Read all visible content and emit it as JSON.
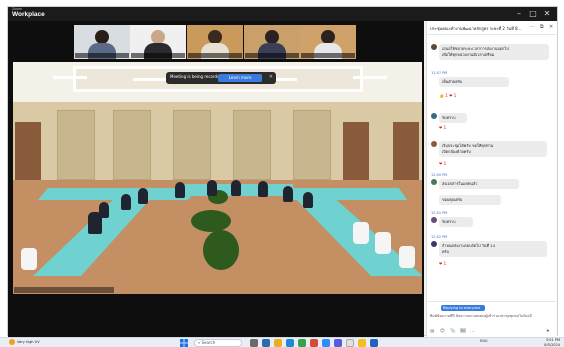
{
  "window": {
    "app_name_small": "Zoom",
    "app_name": "Workplace",
    "controls": {
      "minimize": "–",
      "maximize": "□",
      "close": "✕"
    }
  },
  "meeting": {
    "tiles": [
      {
        "name": ""
      },
      {
        "name": ""
      },
      {
        "name": ""
      },
      {
        "name": ""
      },
      {
        "name": ""
      }
    ],
    "recording_banner": {
      "text": "Meeting is being recorded",
      "button": "Learn more",
      "close": "✕"
    },
    "room_caption": ""
  },
  "chat": {
    "title": "ประชุมคณะทำงานพัฒนาหลักสูตร ระยะที่ 2 วันที่ 8...",
    "header_icons": {
      "more": "···",
      "popout": "⧉",
      "close": "✕"
    },
    "messages": [
      {
        "sender": "",
        "time": "",
        "text_lines": [
          "เสนอให้ขยายระยะเวลาการส่งงานออกไป",
          "เพื่อให้ทุกหน่วยงานมีเวลาเตรียม"
        ],
        "reaction": ""
      },
      {
        "sender": "",
        "time": "11:57 PM",
        "text_lines": [
          "เห็นด้วยครับ"
        ],
        "reaction": "👍 1  ❤ 1"
      },
      {
        "sender": "",
        "time": "",
        "text_lines": [
          "รับทราบ"
        ],
        "reaction": "❤ 1"
      },
      {
        "sender": "",
        "time": "",
        "text_lines": [
          "เริ่มประชุมได้ครับ ขอให้ทุกท่าน",
          "เปิดกล้องด้วยครับ"
        ],
        "reaction": "❤ 1"
      },
      {
        "sender": "",
        "time": "12:00 PM",
        "text_lines": [
          "ส่งเอกสารในแชทแล้ว"
        ],
        "reaction": ""
      },
      {
        "sender": "",
        "time": "",
        "text_lines": [
          "ขอบคุณครับ"
        ],
        "reaction": ""
      },
      {
        "sender": "",
        "time": "12:01 PM",
        "text_lines": [
          "รับทราบ"
        ],
        "reaction": ""
      },
      {
        "sender": "",
        "time": "12:02 PM",
        "text_lines": [
          "กำหนดส่งงานรอบถัดไป วันที่ 14",
          "ครับ"
        ],
        "reaction": "❤ 1"
      }
    ],
    "compose": {
      "reply_label": "Replying to everyone",
      "draft": "พิมพ์ข้อความที่นี่ ข้อความจะแสดงต่อผู้เข้าร่วมประชุมทุกคนในห้องนี้",
      "tools": [
        "@",
        "😊",
        "📎",
        "🖼",
        "…"
      ],
      "send": "➤"
    }
  },
  "taskbar": {
    "weather_text": "Very high UV",
    "search_placeholder": "Search",
    "tray_text": "ENG",
    "clock_time": "3:01 PM",
    "clock_date": "8/5/2024"
  },
  "colors": {
    "accent": "#3a7be0",
    "titlebar": "#1b1b1b",
    "table_cloth": "#6fd1d0",
    "floor": "#c38f63"
  }
}
